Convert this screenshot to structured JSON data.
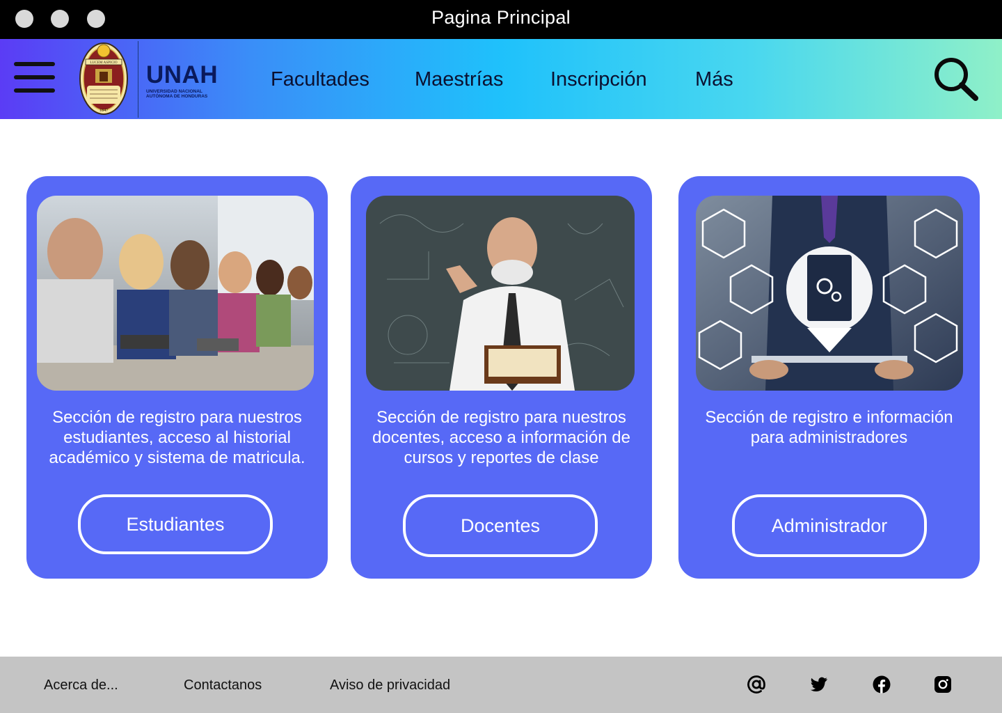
{
  "window": {
    "title": "Pagina Principal"
  },
  "brand": {
    "name": "UNAH",
    "subtitle_line1": "UNIVERSIDAD NACIONAL",
    "subtitle_line2": "AUTÓNOMA DE HONDURAS",
    "seal_banner": "LUCEM ASPICIO",
    "seal_year": "1847"
  },
  "nav": {
    "items": [
      {
        "label": "Facultades"
      },
      {
        "label": "Maestrías"
      },
      {
        "label": "Inscripción"
      },
      {
        "label": "Más"
      }
    ]
  },
  "cards": [
    {
      "text": "Sección de registro para nuestros estudiantes, acceso al historial académico y sistema de matricula.",
      "button": "Estudiantes"
    },
    {
      "text": "Sección de registro para nuestros docentes, acceso a información de cursos y reportes de clase",
      "button": "Docentes"
    },
    {
      "text": "Sección de registro e información para administradores",
      "button": "Administrador"
    }
  ],
  "footer": {
    "links": [
      {
        "label": "Acerca de..."
      },
      {
        "label": "Contactanos"
      },
      {
        "label": "Aviso de privacidad"
      }
    ],
    "social": [
      "email-at-icon",
      "twitter-icon",
      "facebook-icon",
      "instagram-icon"
    ]
  },
  "colors": {
    "card_bg": "#5769f6",
    "titlebar": "#000000",
    "footer": "#c4c4c4",
    "gradient": [
      "#5b3cf5",
      "#1fc1fb",
      "#8ff0c8"
    ]
  }
}
